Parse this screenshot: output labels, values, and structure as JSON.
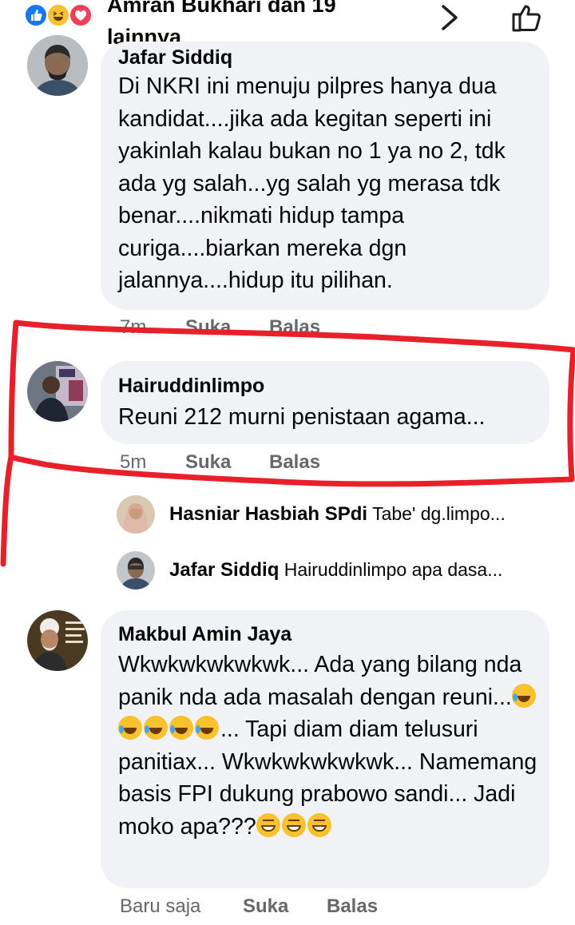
{
  "header": {
    "text": "Amran Bukhari dan 19 lainnya"
  },
  "comments": [
    {
      "name": "Jafar Siddiq",
      "text": "Di NKRI ini menuju pilpres hanya dua kandidat....jika ada kegitan seperti ini yakinlah kalau bukan no 1 ya no 2, tdk ada yg salah...yg salah yg merasa tdk benar....nikmati hidup tampa curiga....biarkan mereka dgn jalannya....hidup itu pilihan.",
      "time": "7m",
      "like": "Suka",
      "reply": "Balas"
    },
    {
      "name": "Hairuddinlimpo",
      "text": "Reuni 212 murni penistaan agama...",
      "time": "5m",
      "like": "Suka",
      "reply": "Balas"
    },
    {
      "name": "Makbul Amin Jaya",
      "text_part1": "Wkwkwkwkwkwk... Ada yang bilang nda panik nda ada masalah dengan reuni...",
      "text_part2": "... Tapi diam diam telusuri panitiax... Wkwkwkwkwkwk... Namemang basis FPI dukung prabowo sandi... Jadi moko apa???",
      "time": "Baru saja",
      "like": "Suka",
      "reply": "Balas"
    }
  ],
  "replies": [
    {
      "name": "Hasniar Hasbiah SPdi",
      "snippet": "Tabe' dg.limpo..."
    },
    {
      "name": "Jafar Siddiq",
      "snippet": "Hairuddinlimpo apa dasa..."
    }
  ],
  "colors": {
    "bubble": "#f0f2f5",
    "annotation": "#e8202a",
    "meta": "#65676b",
    "like_blue": "#1877f2"
  }
}
